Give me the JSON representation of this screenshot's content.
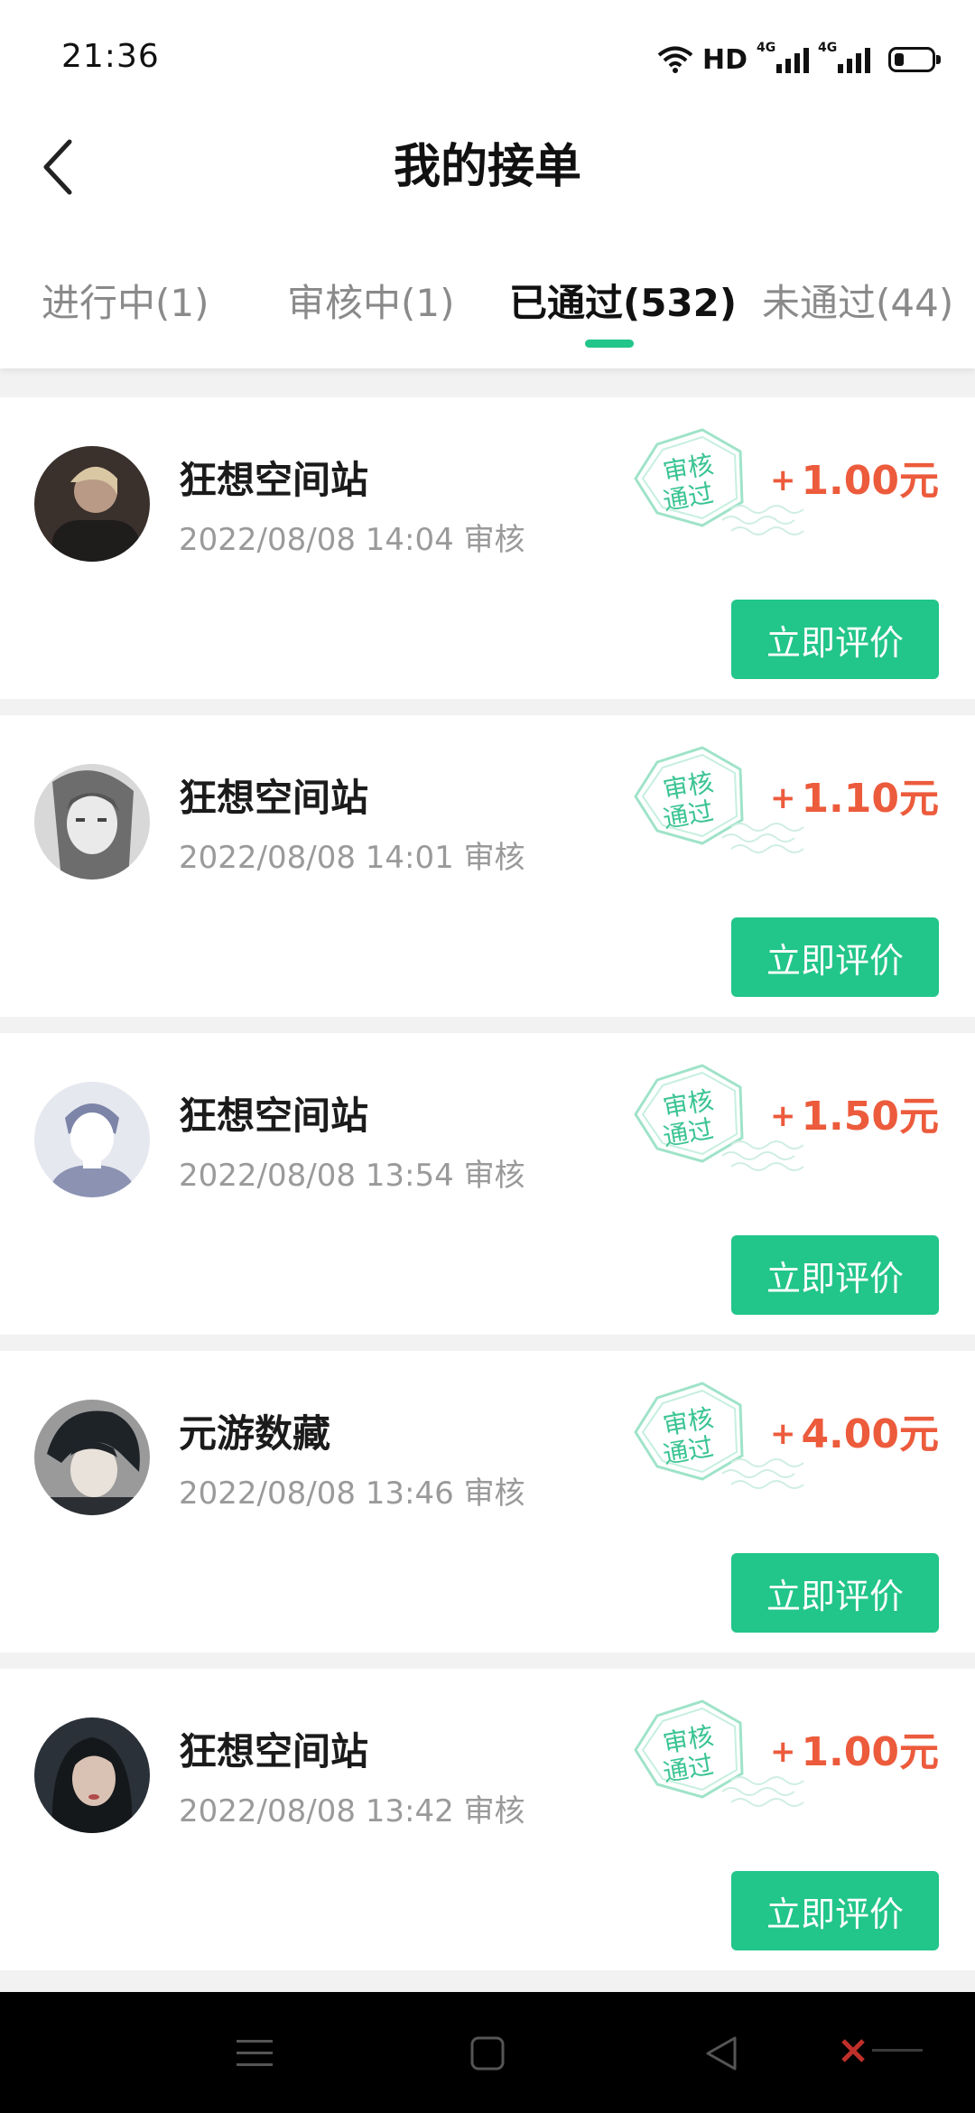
{
  "status_bar": {
    "time": "21:36",
    "hd_label": "HD",
    "network_1": "4G",
    "network_2": "4G",
    "icons": [
      "wifi-icon",
      "signal-icon",
      "signal-icon",
      "battery-icon"
    ]
  },
  "nav": {
    "title": "我的接单",
    "back_icon": "chevron-left-icon"
  },
  "tabs": [
    {
      "label": "进行中(1)",
      "active": false
    },
    {
      "label": "审核中(1)",
      "active": false
    },
    {
      "label": "已通过(532)",
      "active": true
    },
    {
      "label": "未通过(44)",
      "active": false
    }
  ],
  "stamp": {
    "line1": "审核",
    "line2": "通过"
  },
  "colors": {
    "accent_green": "#22c58a",
    "amount_red": "#ec5b3c"
  },
  "orders": [
    {
      "name": "狂想空间站",
      "meta": "2022/08/08 14:04 审核",
      "plus": "+",
      "amount": "1.00元",
      "button": "立即评价"
    },
    {
      "name": "狂想空间站",
      "meta": "2022/08/08 14:01 审核",
      "plus": "+",
      "amount": "1.10元",
      "button": "立即评价"
    },
    {
      "name": "狂想空间站",
      "meta": "2022/08/08 13:54 审核",
      "plus": "+",
      "amount": "1.50元",
      "button": "立即评价"
    },
    {
      "name": "元游数藏",
      "meta": "2022/08/08 13:46 审核",
      "plus": "+",
      "amount": "4.00元",
      "button": "立即评价"
    },
    {
      "name": "狂想空间站",
      "meta": "2022/08/08 13:42 审核",
      "plus": "+",
      "amount": "1.00元",
      "button": "立即评价"
    }
  ],
  "system_nav": {
    "icons": [
      "menu-icon",
      "home-square-icon",
      "back-triangle-icon"
    ]
  }
}
